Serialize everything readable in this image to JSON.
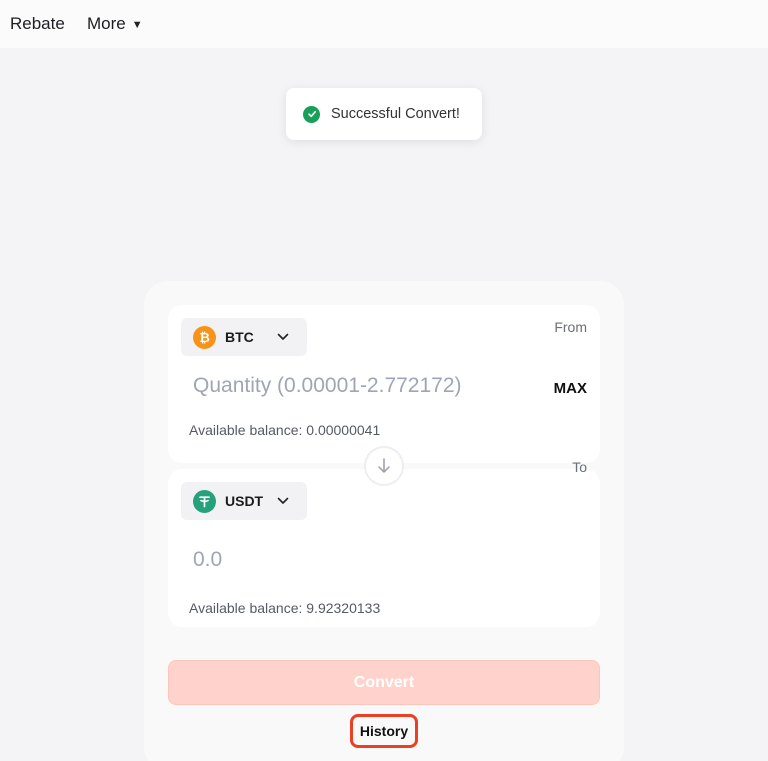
{
  "nav": {
    "rebate": "Rebate",
    "more": "More"
  },
  "toast": {
    "message": "Successful Convert!"
  },
  "convert": {
    "from": {
      "label": "From",
      "coin": "BTC",
      "placeholder": "Quantity (0.00001-2.772172)",
      "max_label": "MAX",
      "balance": "Available balance: 0.00000041"
    },
    "to": {
      "label": "To",
      "coin": "USDT",
      "value": "0.0",
      "balance": "Available balance: 9.92320133"
    },
    "button_label": "Convert",
    "history_label": "History"
  },
  "colors": {
    "success": "#18a058",
    "btc": "#f7931a",
    "usdt": "#26a17b",
    "convert_disabled": "#ffd3cc",
    "highlight": "#ea4124"
  },
  "icons": [
    "check-circle-icon",
    "caret-down-icon",
    "bitcoin-icon",
    "tether-icon",
    "chevron-down-icon",
    "arrow-down-icon"
  ]
}
